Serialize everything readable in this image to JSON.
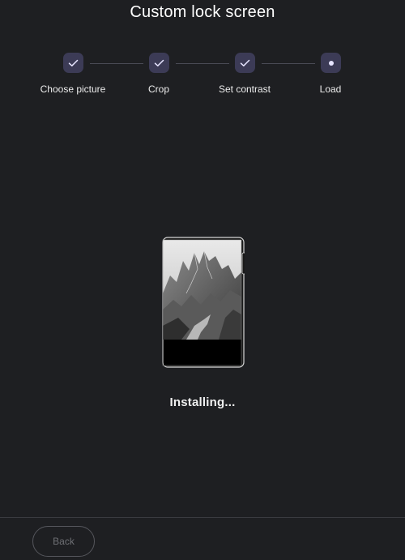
{
  "page": {
    "title": "Custom lock screen"
  },
  "steps": [
    {
      "label": "Choose picture",
      "state": "done",
      "icon": "check-icon"
    },
    {
      "label": "Crop",
      "state": "done",
      "icon": "check-icon"
    },
    {
      "label": "Set contrast",
      "state": "done",
      "icon": "check-icon"
    },
    {
      "label": "Load",
      "state": "active",
      "icon": "dot-icon"
    }
  ],
  "status": {
    "text": "Installing..."
  },
  "footer": {
    "back_label": "Back"
  },
  "colors": {
    "background": "#1e1f22",
    "step_circle": "#3c3b56",
    "step_line": "#4a4b55",
    "text": "#ffffff",
    "disabled_button_text": "#6f7075"
  }
}
